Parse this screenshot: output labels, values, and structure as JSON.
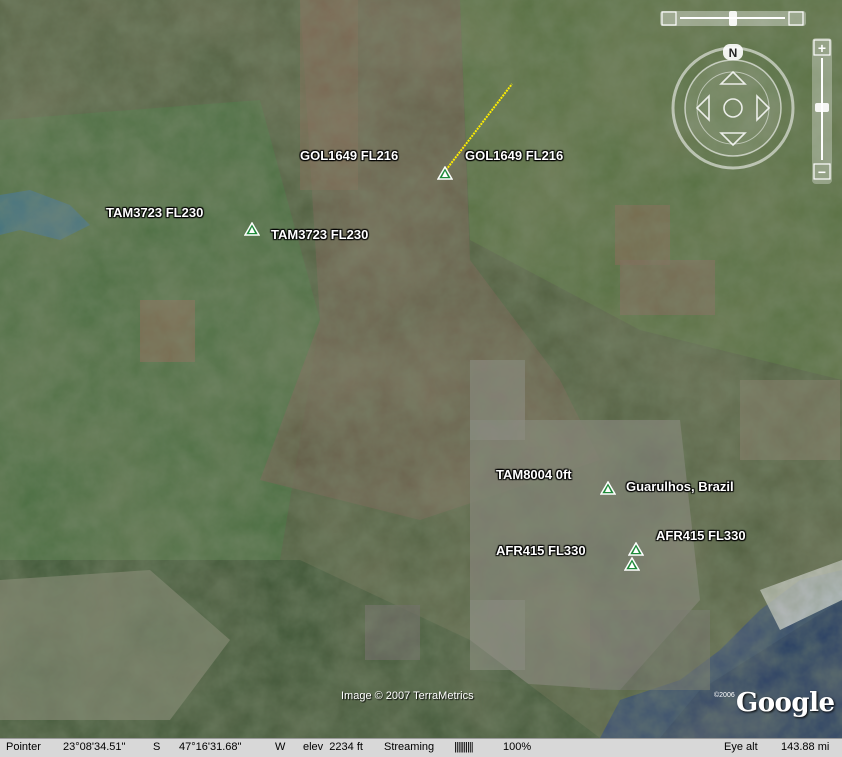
{
  "map": {
    "aircraft": [
      {
        "left_label": "GOL1649 FL216",
        "right_label": "GOL1649 FL216"
      },
      {
        "left_label": "TAM3723 FL230",
        "right_label": "TAM3723 FL230"
      },
      {
        "left_label": "TAM8004 0ft",
        "right_label": "Guarulhos, Brazil"
      },
      {
        "left_label": "AFR415 FL330",
        "right_label": "AFR415 FL330"
      }
    ],
    "copyright": "Image © 2007 TerraMetrics",
    "logo_year": "©2006",
    "logo_text": "Google"
  },
  "nav": {
    "compass_letter": "N",
    "zoom_in": "+",
    "zoom_out": "−"
  },
  "status": {
    "pointer_label": "Pointer",
    "lat": "23°08'34.51\"",
    "lat_hem": "S",
    "lon": "47°16'31.68\"",
    "lon_hem": "W",
    "elev": "elev  2234 ft",
    "streaming": "Streaming",
    "stream_bars": "||||||||||",
    "stream_pct": "100%",
    "eye_label": "Eye alt",
    "eye_value": "143.88 mi"
  },
  "colors": {
    "marker_fill": "#1f8a3a",
    "track": "#ffee00"
  }
}
